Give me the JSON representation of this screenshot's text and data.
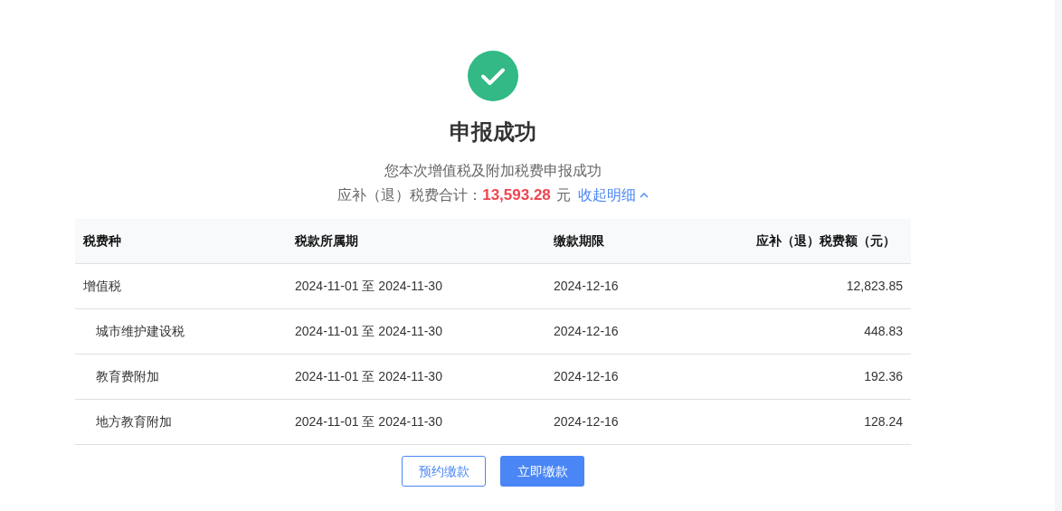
{
  "result": {
    "title": "申报成功",
    "message": "您本次增值税及附加税费申报成功",
    "total_label": "应补（退）税费合计：",
    "total_amount": "13,593.28",
    "total_unit": "元",
    "toggle_label": "收起明细",
    "expanded": true
  },
  "table": {
    "columns": [
      "税费种",
      "税款所属期",
      "缴款期限",
      "应补（退）税费额（元）"
    ],
    "rows": [
      {
        "cells": [
          "增值税",
          "2024-11-01 至 2024-11-30",
          "2024-12-16",
          "12,823.85"
        ],
        "children": [
          {
            "cells": [
              "城市维护建设税",
              "2024-11-01 至 2024-11-30",
              "2024-12-16",
              "448.83"
            ]
          },
          {
            "cells": [
              "教育费附加",
              "2024-11-01 至 2024-11-30",
              "2024-12-16",
              "192.36"
            ]
          },
          {
            "cells": [
              "地方教育附加",
              "2024-11-01 至 2024-11-30",
              "2024-12-16",
              "128.24"
            ]
          }
        ]
      }
    ]
  },
  "buttons": [
    {
      "label": "预约缴款",
      "kind": "secondary"
    },
    {
      "label": "立即缴款",
      "kind": "primary"
    }
  ]
}
